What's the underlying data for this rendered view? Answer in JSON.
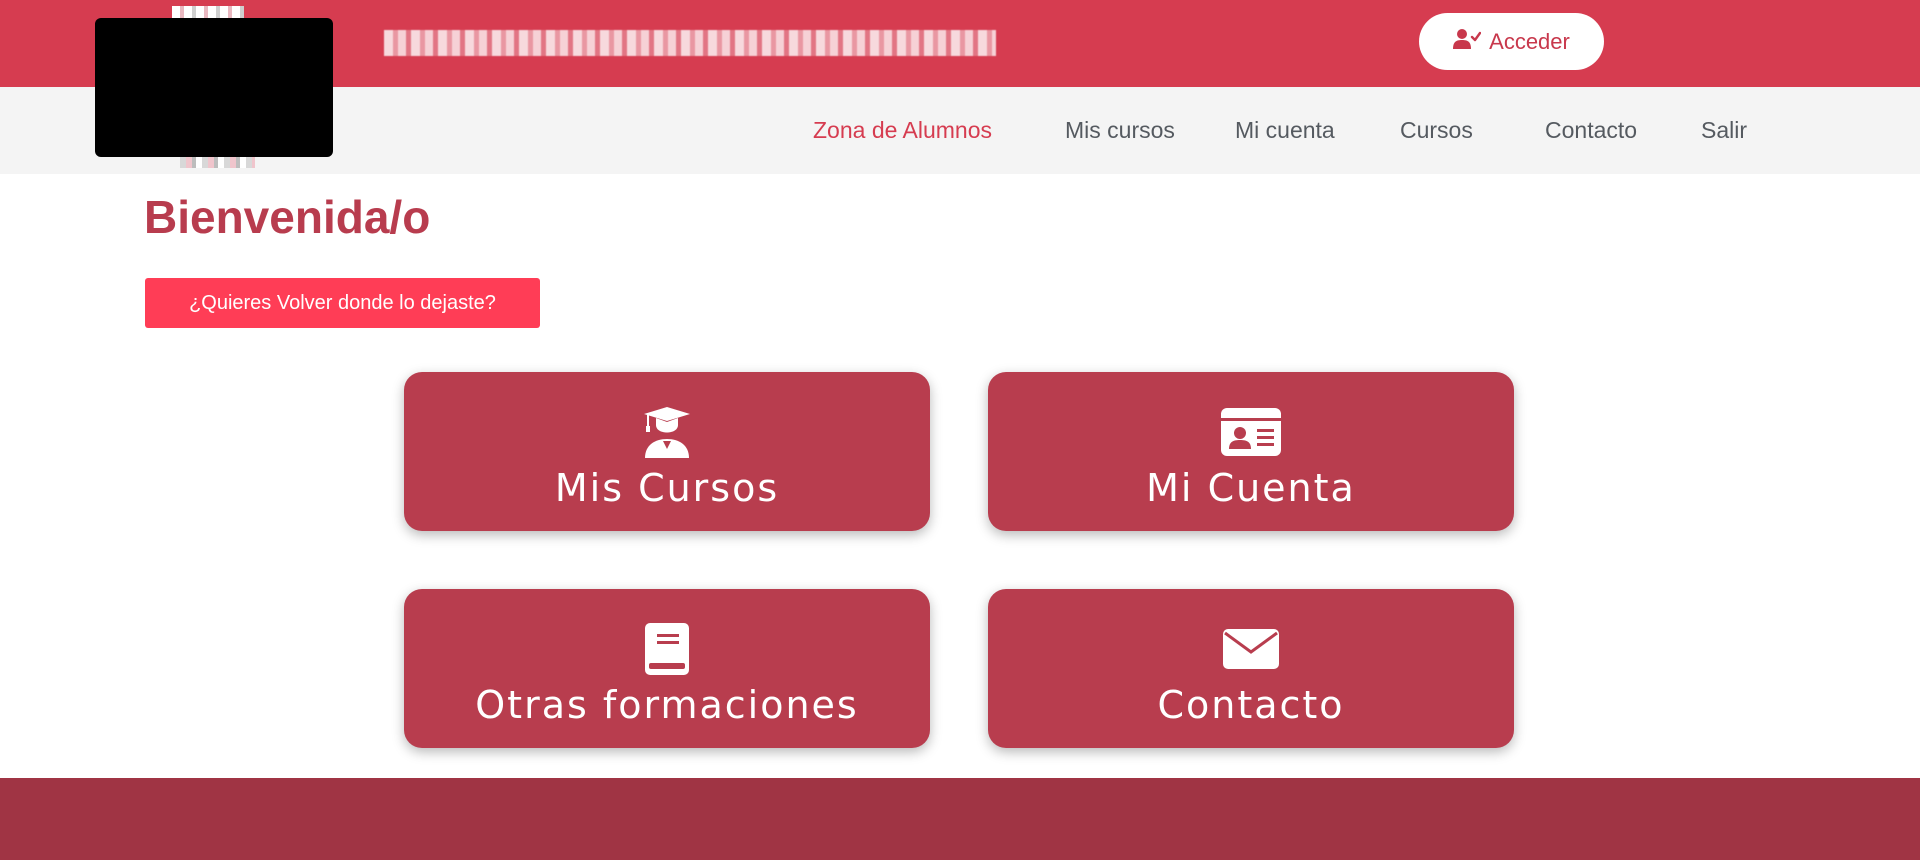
{
  "header": {
    "login_label": "Acceder"
  },
  "nav": {
    "items": [
      {
        "label": "Zona de Alumnos",
        "active": true
      },
      {
        "label": "Mis cursos"
      },
      {
        "label": "Mi cuenta"
      },
      {
        "label": "Cursos"
      },
      {
        "label": "Contacto"
      },
      {
        "label": "Salir"
      }
    ]
  },
  "main": {
    "title": "Bienvenida/o",
    "resume_button": "¿Quieres Volver donde lo dejaste?",
    "cards": [
      {
        "label": "Mis Cursos",
        "icon": "graduate-icon"
      },
      {
        "label": "Mi Cuenta",
        "icon": "id-card-icon"
      },
      {
        "label": "Otras formaciones",
        "icon": "book-icon"
      },
      {
        "label": "Contacto",
        "icon": "envelope-icon"
      }
    ]
  },
  "colors": {
    "brand": "#d63c50",
    "card": "#b83d4e",
    "button": "#ff3d56",
    "footer": "#a03444"
  }
}
